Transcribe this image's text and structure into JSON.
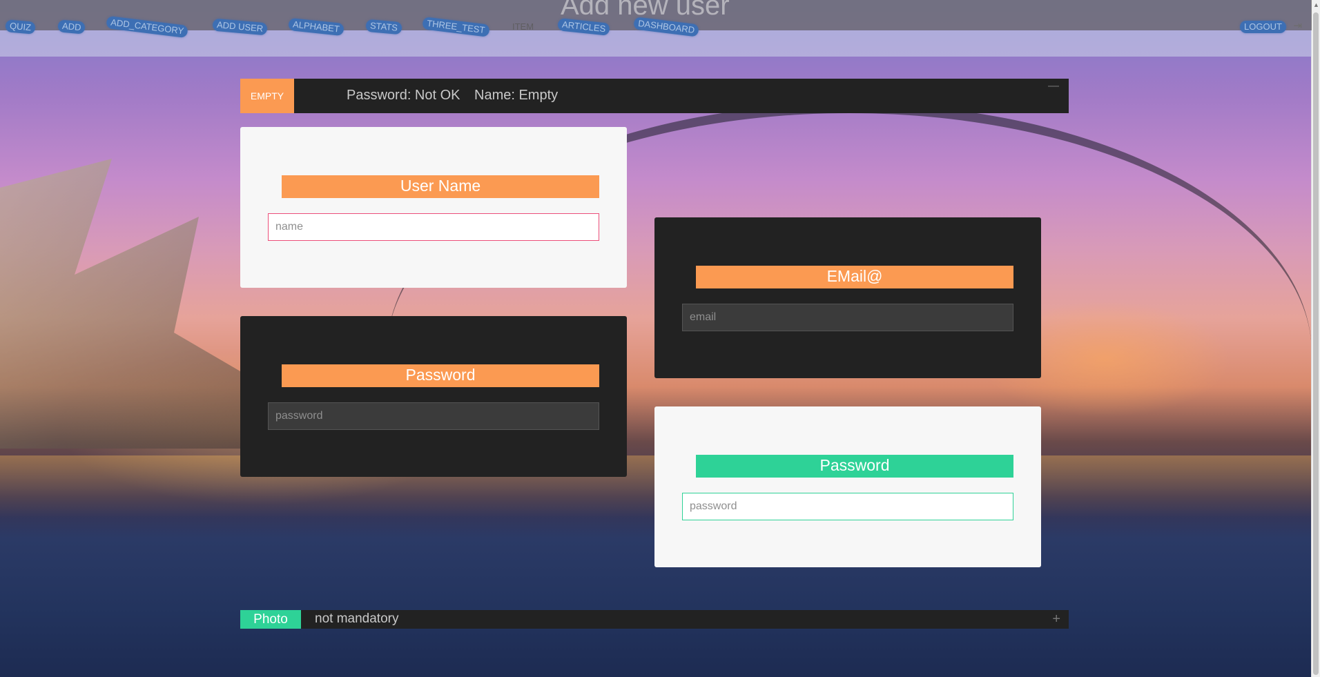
{
  "page": {
    "title": "Add new user"
  },
  "nav": {
    "items": [
      {
        "label": "QUIZ"
      },
      {
        "label": "ADD"
      },
      {
        "label": "ADD_CATEGORY"
      },
      {
        "label": "ADD USER"
      },
      {
        "label": "ALPHABET"
      },
      {
        "label": "STATS"
      },
      {
        "label": "THREE_TEST"
      },
      {
        "label": "ITEM"
      },
      {
        "label": "ARTICLES"
      },
      {
        "label": "DASHBOARD"
      }
    ],
    "logout_label": "LOGOUT",
    "logout_icon": "logout-icon"
  },
  "status": {
    "badge": "EMPTY",
    "password_status": "Password: Not OK",
    "name_status": "Name: Empty",
    "minimize_glyph": "—"
  },
  "form": {
    "username": {
      "label": "User Name",
      "placeholder": "name",
      "value": ""
    },
    "email": {
      "label": "EMail@",
      "placeholder": "email",
      "value": ""
    },
    "password": {
      "label": "Password",
      "placeholder": "password",
      "value": ""
    },
    "password_confirm": {
      "label": "Password",
      "placeholder": "password",
      "value": ""
    }
  },
  "photo": {
    "badge": "Photo",
    "note": "not mandatory",
    "expand_glyph": "+"
  },
  "colors": {
    "accent_orange": "#fb9a52",
    "accent_green": "#2ed297",
    "error_pink": "#ec4d79",
    "panel_dark": "#222222",
    "panel_light": "#f7f7f7",
    "nav_pill": "#3d6fb4"
  }
}
